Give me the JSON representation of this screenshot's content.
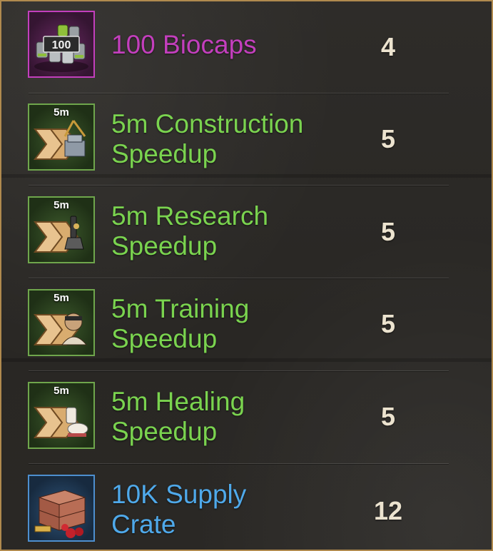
{
  "colors": {
    "frame_border": "#b08a4e",
    "epic_purple": "#c33fbd",
    "uncommon_green": "#7ad34f",
    "rare_blue": "#4fa9ea",
    "quantity": "#ece3cf"
  },
  "items": [
    {
      "name_lines": [
        "100 Biocaps"
      ],
      "quantity": "4",
      "icon_label": "100",
      "badge": "",
      "icon": "biocaps-icon",
      "rarity": "purple"
    },
    {
      "name_lines": [
        "5m Construction",
        "Speedup"
      ],
      "quantity": "5",
      "badge": "5m",
      "icon": "construction-speedup-icon",
      "rarity": "green"
    },
    {
      "name_lines": [
        "5m Research",
        "Speedup"
      ],
      "quantity": "5",
      "badge": "5m",
      "icon": "research-speedup-icon",
      "rarity": "green"
    },
    {
      "name_lines": [
        "5m Training",
        "Speedup"
      ],
      "quantity": "5",
      "badge": "5m",
      "icon": "training-speedup-icon",
      "rarity": "green"
    },
    {
      "name_lines": [
        "5m Healing",
        "Speedup"
      ],
      "quantity": "5",
      "badge": "5m",
      "icon": "healing-speedup-icon",
      "rarity": "green"
    },
    {
      "name_lines": [
        "10K Supply",
        "Crate"
      ],
      "quantity": "12",
      "badge": "",
      "icon": "supply-crate-icon",
      "rarity": "blue"
    }
  ]
}
